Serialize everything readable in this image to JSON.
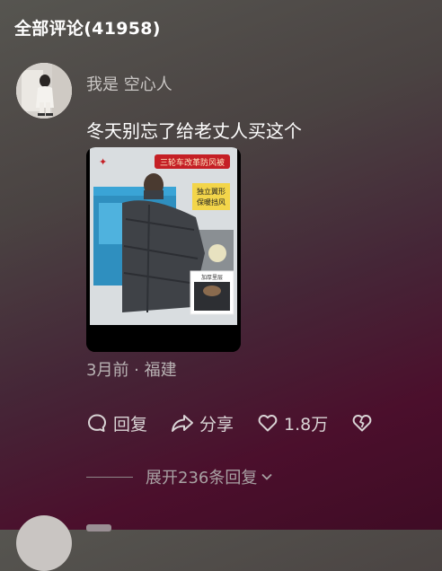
{
  "header": {
    "title": "全部评论(41958)"
  },
  "comment": {
    "username": "我是 空心人",
    "text": "冬天别忘了给老丈人买这个",
    "image": {
      "banner_text": "三轮车改革防风被",
      "tag_text_line1": "独立翼形",
      "tag_text_line2": "保暖挡风",
      "detail_label": "加厚里层"
    },
    "meta": "3月前 · 福建",
    "actions": {
      "reply_label": "回复",
      "share_label": "分享",
      "like_count": "1.8万"
    },
    "expand_replies": "展开236条回复"
  },
  "colors": {
    "bg_top": "#565550",
    "bg_bottom": "#4b0f2c",
    "text_primary": "#ffffff",
    "text_secondary": "#b9b3b4"
  }
}
